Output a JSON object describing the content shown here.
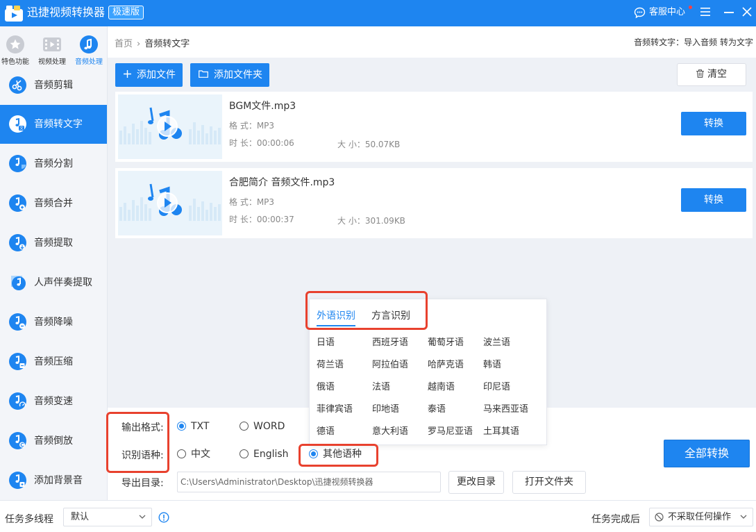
{
  "app": {
    "title": "迅捷视频转换器",
    "edition": "极速版",
    "service_label": "客服中心"
  },
  "categories": [
    {
      "label": "特色功能",
      "icon": "star-icon"
    },
    {
      "label": "视频处理",
      "icon": "film-icon"
    },
    {
      "label": "音频处理",
      "icon": "music-note-icon"
    }
  ],
  "sidebar": {
    "items": [
      {
        "label": "音频剪辑"
      },
      {
        "label": "音频转文字"
      },
      {
        "label": "音频分割"
      },
      {
        "label": "音频合并"
      },
      {
        "label": "音频提取"
      },
      {
        "label": "人声伴奏提取"
      },
      {
        "label": "音频降噪"
      },
      {
        "label": "音频压缩"
      },
      {
        "label": "音频变速"
      },
      {
        "label": "音频倒放"
      },
      {
        "label": "添加背景音"
      }
    ]
  },
  "breadcrumb": {
    "home": "首页",
    "separator": "›",
    "current": "音频转文字"
  },
  "hint": "音频转文字：导入音频 转为文字",
  "toolbar": {
    "add_file": "添加文件",
    "add_folder": "添加文件夹",
    "clear": "清空"
  },
  "files": [
    {
      "name": "BGM文件.mp3",
      "format_label": "格  式：",
      "format": "MP3",
      "duration_label": "时  长：",
      "duration": "00:00:06",
      "size_label": "大  小：",
      "size": "50.07KB",
      "action": "转换"
    },
    {
      "name": "合肥简介 音频文件.mp3",
      "format_label": "格  式：",
      "format": "MP3",
      "duration_label": "时  长：",
      "duration": "00:00:37",
      "size_label": "大  小：",
      "size": "301.09KB",
      "action": "转换"
    }
  ],
  "language_popup": {
    "tabs": [
      "外语识别",
      "方言识别"
    ],
    "active_tab": "外语识别",
    "languages": [
      "日语",
      "西班牙语",
      "葡萄牙语",
      "波兰语",
      "荷兰语",
      "阿拉伯语",
      "哈萨克语",
      "韩语",
      "俄语",
      "法语",
      "越南语",
      "印尼语",
      "菲律宾语",
      "印地语",
      "泰语",
      "马来西亚语",
      "德语",
      "意大利语",
      "罗马尼亚语",
      "土耳其语"
    ]
  },
  "settings": {
    "output_format_label": "输出格式:",
    "output_formats": [
      "TXT",
      "WORD"
    ],
    "output_selected": "TXT",
    "language_label": "识别语种:",
    "language_options": [
      "中文",
      "English",
      "其他语种"
    ],
    "language_selected": "其他语种",
    "export_dir_label": "导出目录:",
    "export_dir": "C:\\Users\\Administrator\\Desktop\\迅捷视频转换器",
    "change_dir": "更改目录",
    "open_folder": "打开文件夹",
    "convert_all": "全部转换"
  },
  "statusbar": {
    "threads_label": "任务多线程",
    "threads_value": "默认",
    "after_label": "任务完成后",
    "after_value": "不采取任何操作"
  },
  "colors": {
    "accent": "#1e85f0",
    "highlight_box": "#e8412e",
    "panel_bg": "#eef1f6"
  }
}
